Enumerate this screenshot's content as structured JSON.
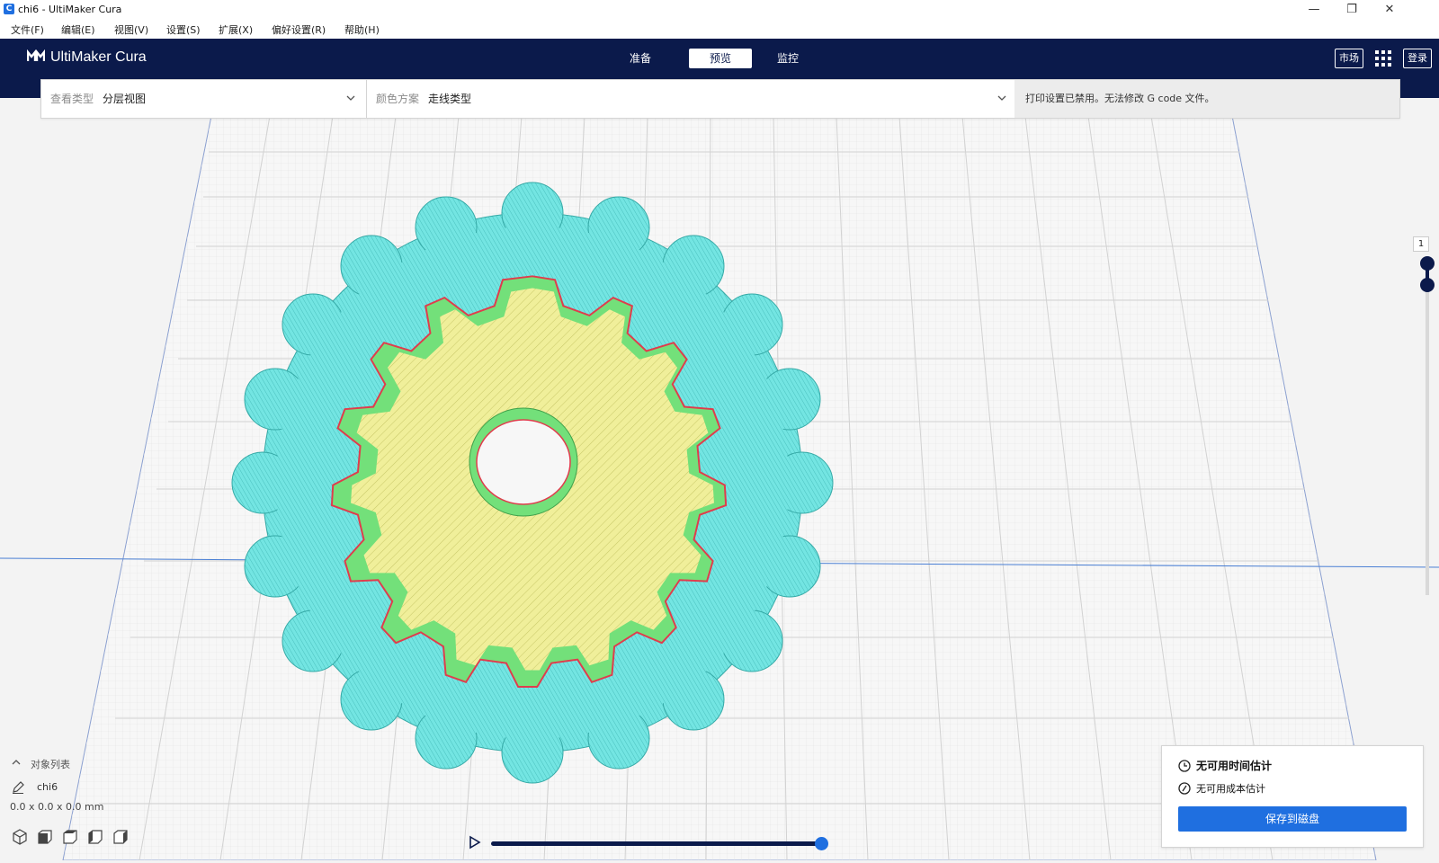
{
  "window": {
    "title": "chi6 - UltiMaker Cura",
    "icon_letter": "C"
  },
  "menu": [
    "文件(F)",
    "编辑(E)",
    "视图(V)",
    "设置(S)",
    "扩展(X)",
    "偏好设置(R)",
    "帮助(H)"
  ],
  "header": {
    "logo": "UltiMaker Cura",
    "stages": [
      "准备",
      "预览",
      "监控"
    ],
    "active_stage": "预览",
    "marketplace": "市场",
    "login": "登录"
  },
  "toolbar": {
    "view_type_label": "查看类型",
    "view_type_value": "分层视图",
    "color_scheme_label": "颜色方案",
    "color_scheme_value": "走线类型",
    "message": "打印设置已禁用。无法修改 G code 文件。"
  },
  "layer_slider": {
    "current_layer": "1"
  },
  "object_list": {
    "label": "对象列表",
    "object_name": "chi6",
    "dimensions": "0.0 x 0.0 x 0.0 mm"
  },
  "print_panel": {
    "time_estimate": "无可用时间估计",
    "cost_estimate": "无可用成本估计",
    "save_button": "保存到磁盘"
  },
  "colors": {
    "header_bg": "#0b1a4b",
    "accent": "#1f6fe0",
    "skirt": "#6fe3df",
    "wall": "#73e07a",
    "outer_wall": "#e03c4c",
    "infill": "#f0ef9a"
  },
  "progress": {
    "playback_fraction": 1.0
  }
}
